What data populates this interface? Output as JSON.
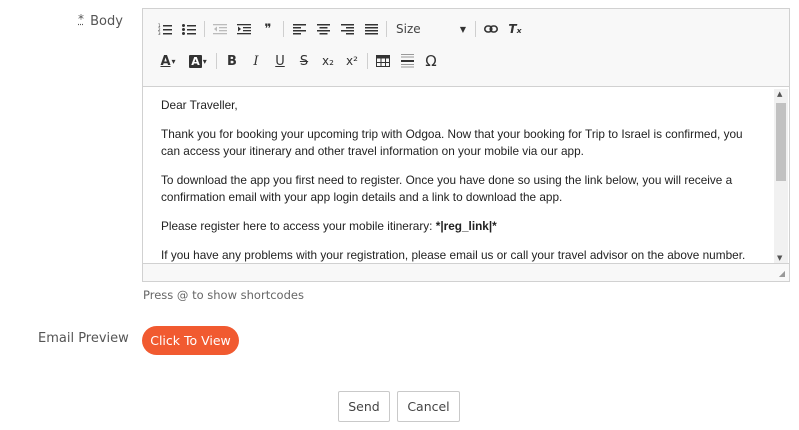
{
  "form": {
    "body_required_mark": "*",
    "body_label": "Body",
    "email_preview_label": "Email Preview",
    "shortcode_hint": "Press @ to show shortcodes",
    "preview_button": "Click To View",
    "send_button": "Send",
    "cancel_button": "Cancel"
  },
  "toolbar": {
    "size_label": "Size",
    "glyphs": {
      "blockquote": "❞",
      "text_color": "A",
      "bg_color": "A",
      "bold": "B",
      "italic": "I",
      "underline": "U",
      "strike": "S",
      "subscript": "x₂",
      "superscript": "x²",
      "special_char": "Ω",
      "link": "🔗",
      "remove_format": "Tₓ"
    }
  },
  "content": {
    "greeting": "Dear Traveller,",
    "para1": "Thank you for booking your upcoming trip with Odgoa. Now that your booking for Trip to Israel is confirmed, you can access your itinerary and other travel information on your mobile via our app.",
    "para2": "To download the app you first need to register. Once you have done so using the link below, you will receive a confirmation email with your app login details and a link to download the app.",
    "para3_prefix": "Please register here to access your mobile itinerary: ",
    "para3_code": "*|reg_link|*",
    "para4_partial": "If you have any problems with your registration, please email us or call your travel advisor on the above number."
  },
  "colors": {
    "accent": "#f15a30",
    "border": "#d1d1d1",
    "toolbar_bg": "#f8f8f8"
  },
  "icons": [
    "numbered-list-icon",
    "bullet-list-icon",
    "outdent-icon",
    "indent-icon",
    "blockquote-icon",
    "align-left-icon",
    "align-center-icon",
    "align-right-icon",
    "justify-icon",
    "link-icon",
    "remove-format-icon",
    "text-color-icon",
    "background-color-icon",
    "bold-icon",
    "italic-icon",
    "underline-icon",
    "strike-icon",
    "subscript-icon",
    "superscript-icon",
    "table-icon",
    "horizontal-line-icon",
    "special-char-icon"
  ]
}
